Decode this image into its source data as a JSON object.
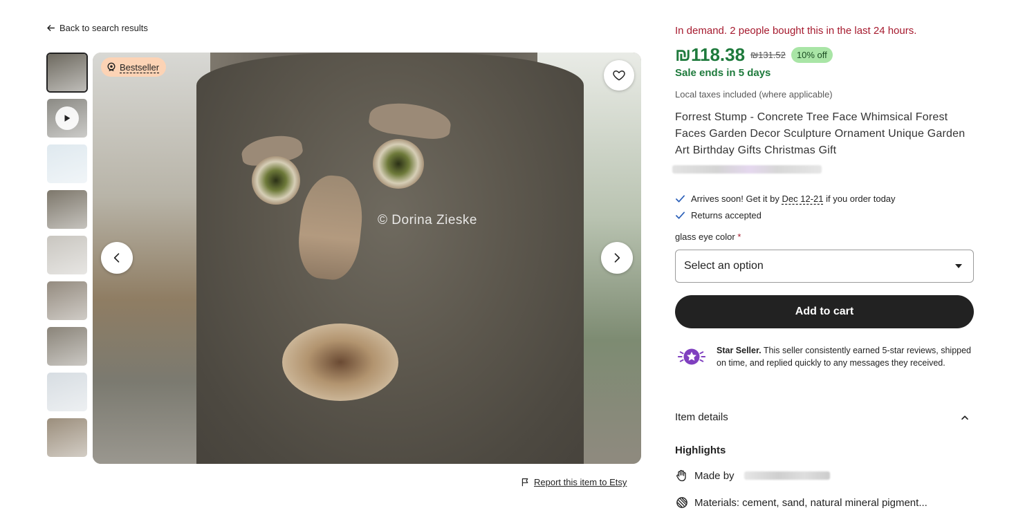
{
  "nav": {
    "back_label": "Back to search results"
  },
  "gallery": {
    "badge_label": "Bestseller",
    "thumbnails": [
      {
        "kind": "photo",
        "color": "#6e6a60"
      },
      {
        "kind": "video",
        "color": "#8b8a84"
      },
      {
        "kind": "photo",
        "color": "#dfe9ef"
      },
      {
        "kind": "photo",
        "color": "#7d776b"
      },
      {
        "kind": "photo",
        "color": "#c9c6c0"
      },
      {
        "kind": "photo",
        "color": "#948b7f"
      },
      {
        "kind": "photo",
        "color": "#8a8479"
      },
      {
        "kind": "photo",
        "color": "#d7dde2"
      },
      {
        "kind": "photo",
        "color": "#9b8e7c"
      }
    ],
    "image_watermark": "© Dorina Zieske",
    "report_label": "Report this item to Etsy"
  },
  "listing": {
    "demand_text": "In demand. 2 people bought this in the last 24 hours.",
    "price": "₪118.38",
    "original_price": "₪131.52",
    "discount": "10% off",
    "sale_ends": "Sale ends in 5 days",
    "taxes_note": "Local taxes included (where applicable)",
    "title": "Forrest Stump - Concrete Tree Face Whimsical Forest Faces Garden Decor Sculpture Ornament Unique Garden Art Birthday Gifts Christmas Gift",
    "arrival_prefix": "Arrives soon! Get it by ",
    "arrival_dates": "Dec 12-21",
    "arrival_suffix": " if you order today",
    "returns": "Returns accepted",
    "variation_label": "glass eye color",
    "required_mark": "*",
    "select_placeholder": "Select an option",
    "add_to_cart": "Add to cart",
    "star_seller_title": "Star Seller.",
    "star_seller_text": " This seller consistently earned 5-star reviews, shipped on time, and replied quickly to any messages they received."
  },
  "details": {
    "section_label": "Item details",
    "highlights_label": "Highlights",
    "made_by_label": "Made by",
    "materials": "Materials: cement, sand, natural mineral pigment..."
  },
  "colors": {
    "demand": "#a61a2e",
    "price": "#1e7a3c",
    "discount_bg": "#a9e5a6",
    "badge_bg": "#fcd3b5",
    "cart_button": "#222222",
    "star_seller": "#7f3fbf"
  },
  "icons": [
    "arrow-left-icon",
    "play-icon",
    "medal-icon",
    "heart-icon",
    "chevron-left-icon",
    "chevron-right-icon",
    "flag-icon",
    "checkmark-icon",
    "star-seller-icon",
    "chevron-up-icon",
    "hand-icon",
    "materials-icon"
  ]
}
